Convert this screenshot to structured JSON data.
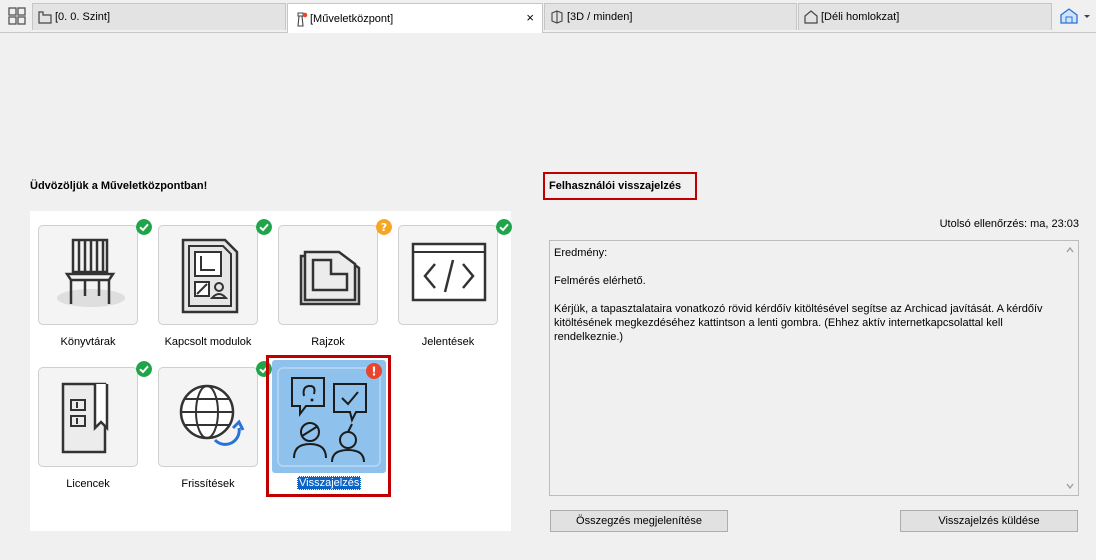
{
  "tabs": [
    {
      "label": "[0. 0. Szint]",
      "icon": "floor-plan-icon",
      "active": false
    },
    {
      "label": "[Műveletközpont]",
      "icon": "action-center-lighthouse-icon",
      "active": true
    },
    {
      "label": "[3D / minden]",
      "icon": "3d-cube-icon",
      "active": false
    },
    {
      "label": "[Déli homlokzat]",
      "icon": "elevation-icon",
      "active": false
    }
  ],
  "tab_close_glyph": "×",
  "left": {
    "title": "Üdvözöljük a Műveletközpontban!",
    "tiles": [
      {
        "label": "Könyvtárak",
        "status": "ok",
        "icon": "library-chair-icon"
      },
      {
        "label": "Kapcsolt modulok",
        "status": "ok",
        "icon": "hotlinked-modules-icon"
      },
      {
        "label": "Rajzok",
        "status": "warning",
        "icon": "drawings-icon"
      },
      {
        "label": "Jelentések",
        "status": "ok",
        "icon": "reports-code-icon"
      },
      {
        "label": "Licencek",
        "status": "ok",
        "icon": "license-icon"
      },
      {
        "label": "Frissítések",
        "status": "ok",
        "icon": "updates-globe-icon"
      },
      {
        "label": "Visszajelzés",
        "status": "error",
        "icon": "feedback-people-icon",
        "selected": true
      }
    ],
    "badge_glyphs": {
      "warning": "?",
      "error": "!"
    }
  },
  "right": {
    "title": "Felhasználói visszajelzés",
    "last_check": "Utolsó ellenőrzés: ma, 23:03",
    "result_label": "Eredmény:",
    "result_status": "Felmérés elérhető.",
    "result_text": "Kérjük, a tapasztalataira vonatkozó rövid kérdőív kitöltésével segítse az Archicad javítását. A kérdőív kitöltésének megkezdéséhez kattintson a lenti gombra. (Ehhez aktív internetkapcsolattal kell rendelkeznie.)",
    "buttons": {
      "show_summary": "Összegzés megjelenítése",
      "send_feedback": "Visszajelzés küldése"
    }
  },
  "colors": {
    "ok": "#1fa44a",
    "warning": "#f5a623",
    "error": "#e8452c",
    "highlight": "#c00000",
    "selected_tile": "#8ec1ec",
    "selection_text_bg": "#0a64c8"
  }
}
